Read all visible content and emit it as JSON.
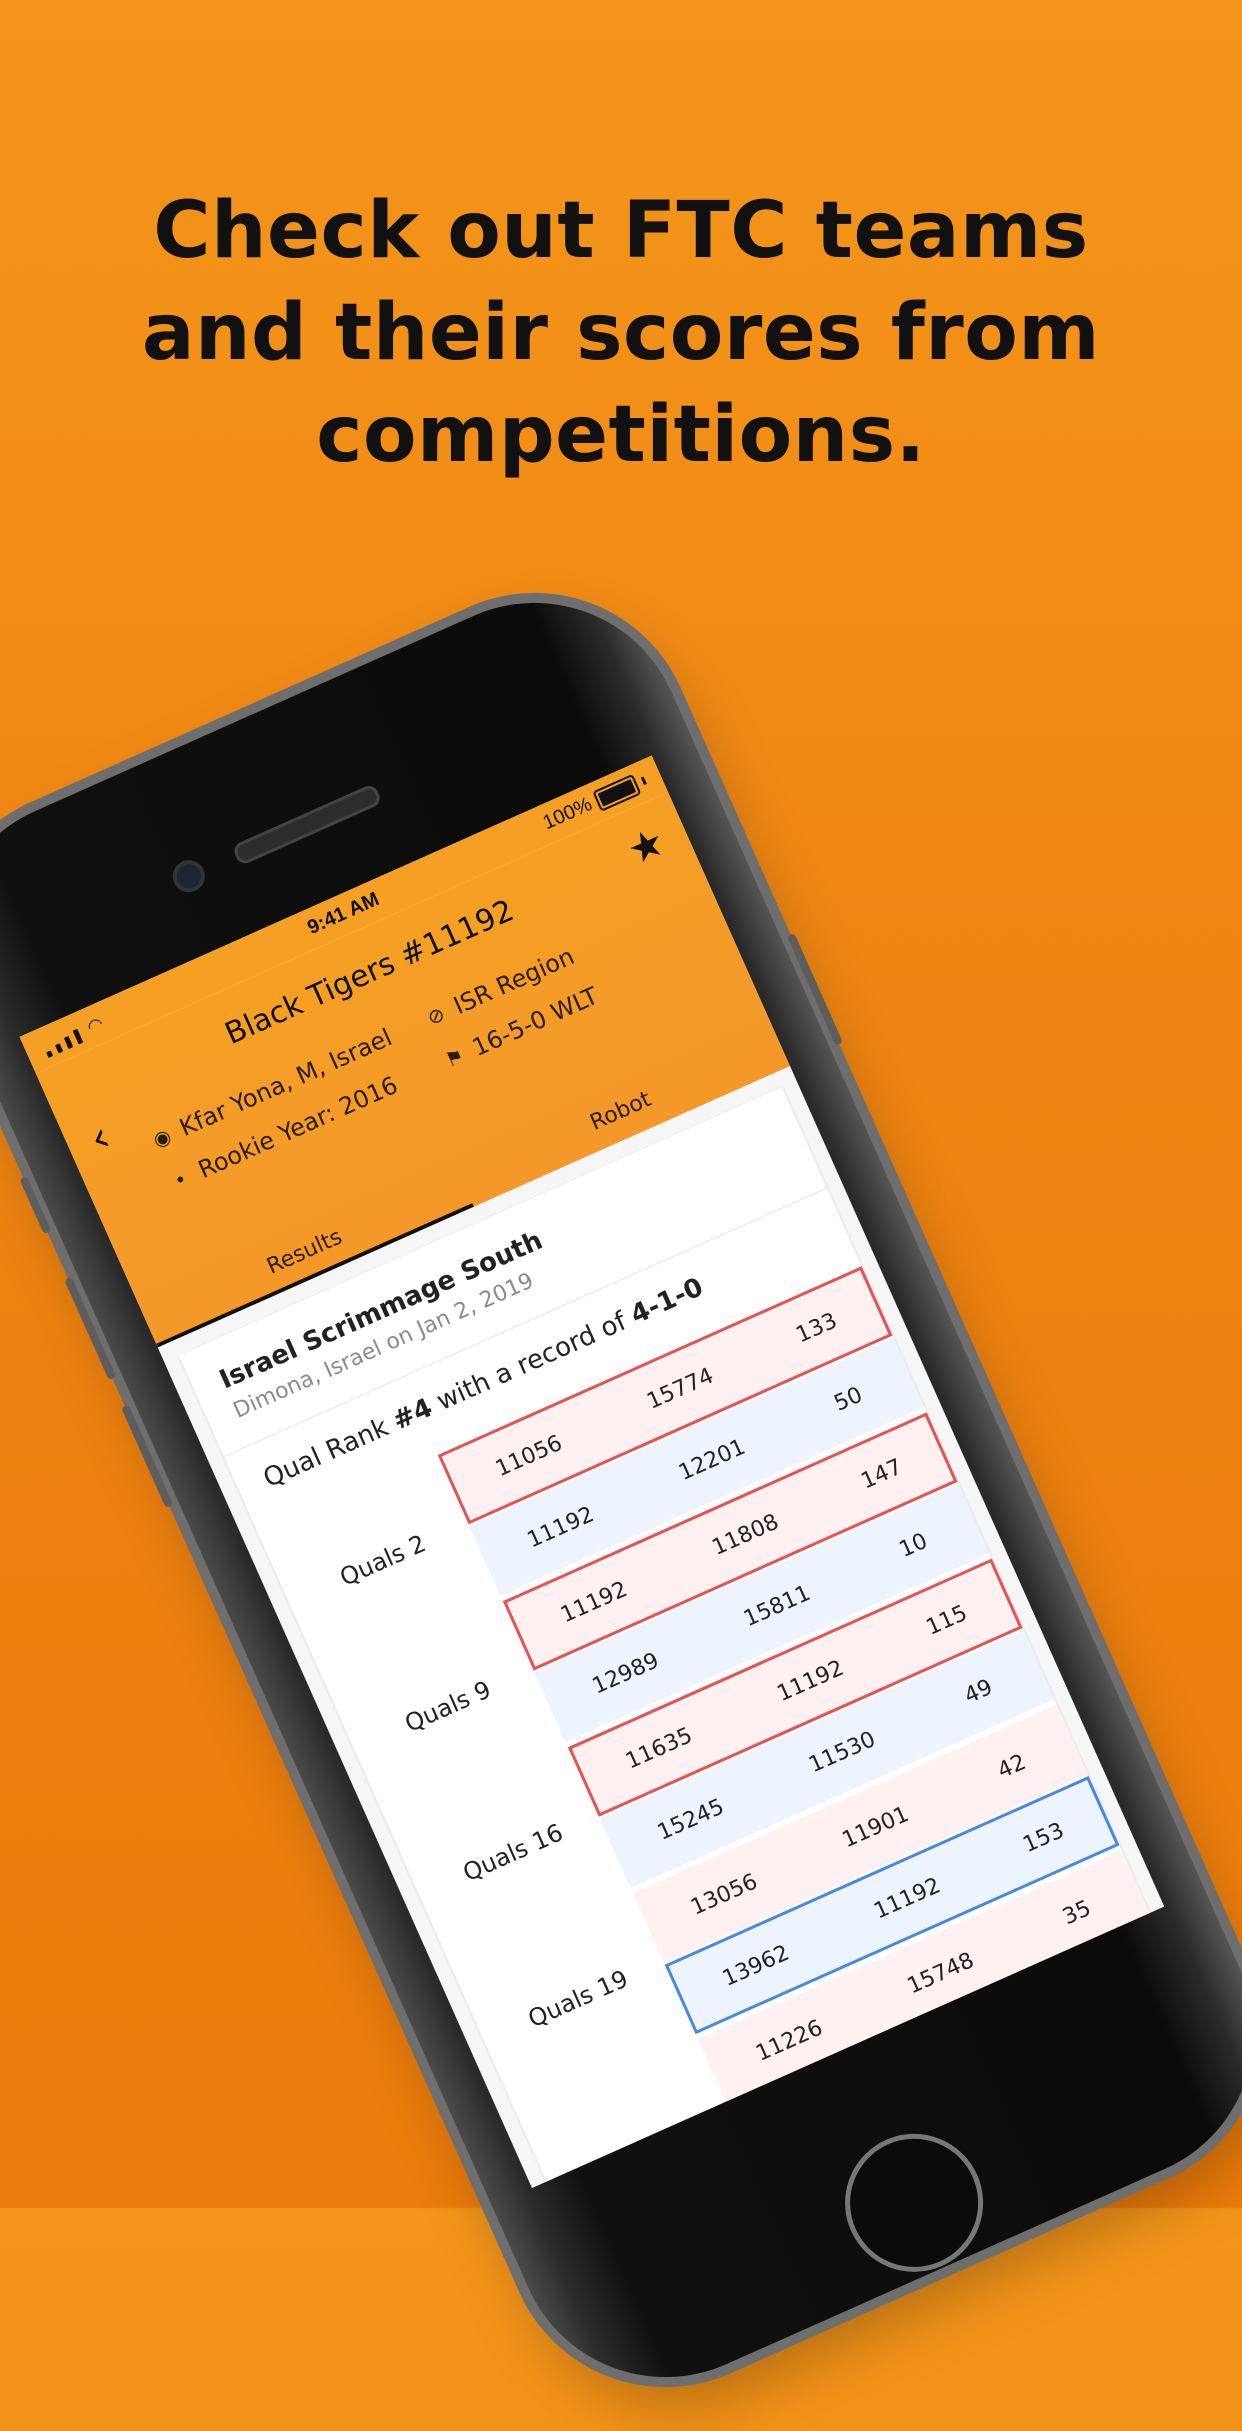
{
  "headline": {
    "line1": "Check out FTC teams",
    "line2": "and their scores from",
    "line3": "competitions."
  },
  "status_bar": {
    "time": "9:41 AM",
    "battery": "100%"
  },
  "header": {
    "team_title": "Black Tigers #11192",
    "location": "Kfar Yona, M, Israel",
    "rookie_year": "Rookie Year: 2016",
    "region": "ISR Region",
    "record": "16-5-0 WLT"
  },
  "icons": {
    "back": "chevron-left-icon",
    "star": "star-icon",
    "location": "map-pin-icon",
    "rookie": "lightbulb-icon",
    "region": "compass-icon",
    "record": "flag-icon"
  },
  "tabs": [
    {
      "label": "Results",
      "selected": true
    },
    {
      "label": "Robot",
      "selected": false
    }
  ],
  "event": {
    "name": "Israel Scrimmage South",
    "subtitle": "Dimona, Israel on Jan 2, 2019",
    "rank_prefix": "Qual Rank ",
    "rank": "#4",
    "rank_middle": " with a record of ",
    "record": "4-1-0"
  },
  "matches": [
    {
      "label": "Quals 2",
      "red": [
        "11056",
        "15774",
        "133"
      ],
      "blue": [
        "11192",
        "12201",
        "50"
      ],
      "winner": "red"
    },
    {
      "label": "Quals 9",
      "red": [
        "11192",
        "11808",
        "147"
      ],
      "blue": [
        "12989",
        "15811",
        "10"
      ],
      "winner": "red"
    },
    {
      "label": "Quals 16",
      "red": [
        "11635",
        "11192",
        "115"
      ],
      "blue": [
        "15245",
        "11530",
        "49"
      ],
      "winner": "red"
    },
    {
      "label": "Quals 19",
      "red": [
        "13056",
        "11901",
        "42"
      ],
      "blue": [
        "13962",
        "11192",
        "153"
      ],
      "winner": "blue"
    },
    {
      "label": "",
      "red": [
        "11226",
        "15748",
        "35"
      ],
      "blue": [
        "",
        "",
        ""
      ],
      "winner": ""
    }
  ],
  "colors": {
    "background": "#ef8512",
    "header": "#f5a024",
    "red_alliance_bg": "#fff1f1",
    "blue_alliance_bg": "#eef4fd",
    "red_win": "#e35353",
    "blue_win": "#4a88df"
  }
}
